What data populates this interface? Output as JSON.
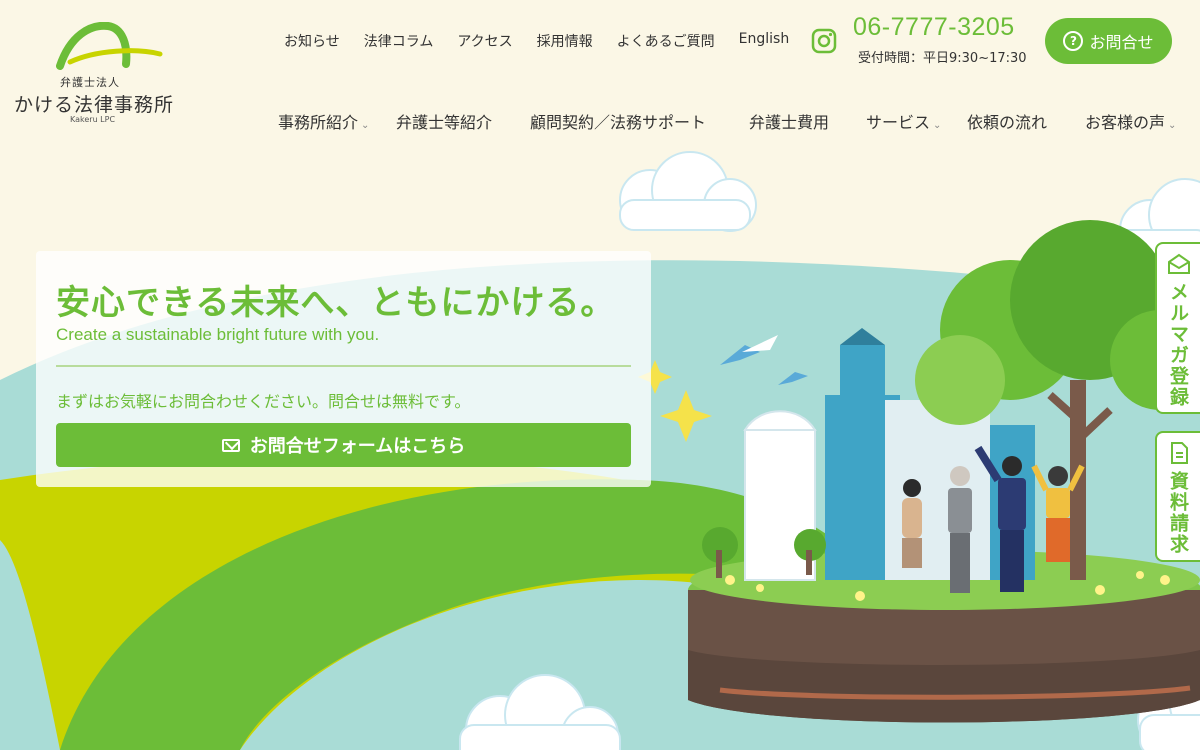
{
  "logo": {
    "sub": "弁護士法人",
    "name": "かける法律事務所",
    "en": "Kakeru LPC"
  },
  "top_nav": [
    "お知らせ",
    "法律コラム",
    "アクセス",
    "採用情報",
    "よくあるご質問",
    "English"
  ],
  "phone": "06-7777-3205",
  "hours": "受付時間：平日9:30~17:30",
  "contact_button": "お問合せ",
  "main_nav": [
    {
      "label": "事務所紹介",
      "has_dropdown": true
    },
    {
      "label": "弁護士等紹介",
      "has_dropdown": false
    },
    {
      "label": "顧問契約／法務サポート",
      "has_dropdown": false
    },
    {
      "label": "弁護士費用",
      "has_dropdown": false
    },
    {
      "label": "サービス",
      "has_dropdown": true
    },
    {
      "label": "依頼の流れ",
      "has_dropdown": false
    },
    {
      "label": "お客様の声",
      "has_dropdown": true
    }
  ],
  "hero": {
    "title": "安心できる未来へ、ともにかける。",
    "subtitle": "Create a sustainable bright future with you.",
    "note": "まずはお気軽にお問合わせください。問合せは無料です。",
    "form_button": "お問合せフォームはこちら"
  },
  "side_tabs": {
    "mail_magazine": "メルマガ登録",
    "documents": "資料請求"
  },
  "colors": {
    "brand_green": "#6cbd38",
    "background": "#fbf7e6",
    "sky_hill": "#a9dcd6",
    "lime": "#c8d400"
  },
  "icons": [
    "instagram-icon",
    "question-icon",
    "mail-icon",
    "envelope-icon",
    "document-icon",
    "chevron-down-icon"
  ]
}
